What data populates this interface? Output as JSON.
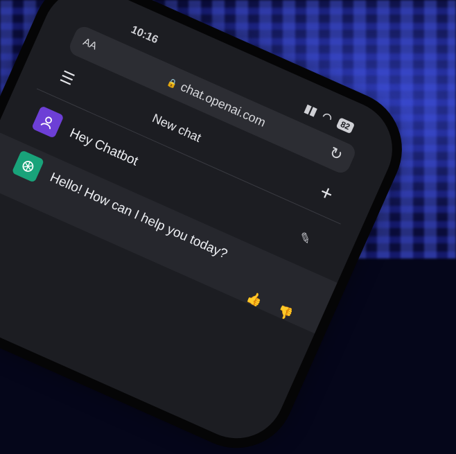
{
  "status": {
    "time": "10:16",
    "battery": "82"
  },
  "browser": {
    "text_size_label": "AA",
    "url": "chat.openai.com"
  },
  "chat": {
    "title": "New chat",
    "messages": [
      {
        "role": "user",
        "text": "Hey Chatbot"
      },
      {
        "role": "assistant",
        "text": "Hello! How can I help you today?"
      }
    ]
  },
  "icons": {
    "menu": "hamburger-icon",
    "reload": "reload-icon",
    "new_chat": "plus-icon",
    "edit": "edit-icon",
    "thumbs_up": "thumbs-up-icon",
    "thumbs_down": "thumbs-down-icon"
  },
  "colors": {
    "user_avatar": "#6d3fd6",
    "assistant_avatar": "#19a37a"
  }
}
